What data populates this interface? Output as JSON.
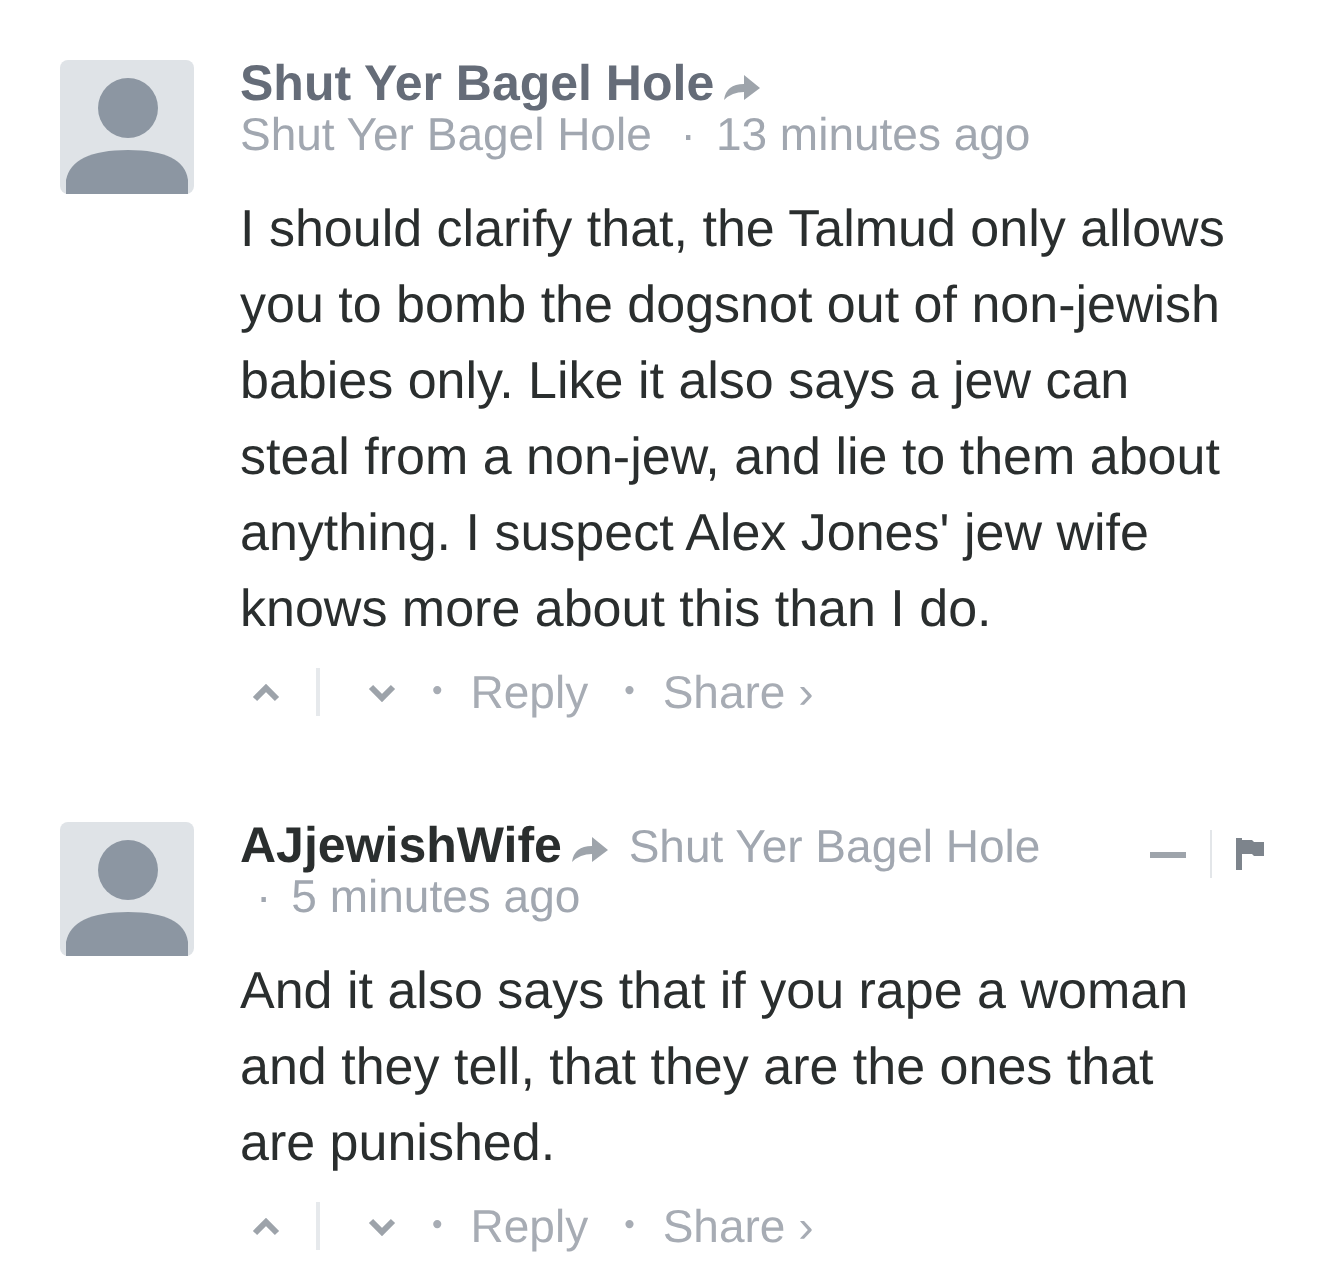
{
  "comments": [
    {
      "author": {
        "name": "Shut Yer Bagel Hole",
        "color": "#656c78"
      },
      "reply_to": "Shut Yer Bagel Hole",
      "separator": "·",
      "time": "13 minutes ago",
      "hovered": false,
      "body": "I should clarify that, the Talmud only allows you to bomb the dogsnot out of non-jewish babies only. Like it also says a jew can steal from a non-jew, and lie to them about anything. I suspect Alex Jones' jew wife knows more about this than I do.",
      "actions": [
        {
          "kind": "upvote"
        },
        {
          "kind": "downvote"
        },
        {
          "kind": "bullet",
          "text": "•"
        },
        {
          "kind": "link",
          "text": "Reply"
        },
        {
          "kind": "bullet",
          "text": "•"
        },
        {
          "kind": "link",
          "text": "Share ›"
        }
      ]
    },
    {
      "author": {
        "name": "AJjewishWife",
        "color": "#2a2e2e"
      },
      "reply_to": "Shut Yer Bagel Hole",
      "separator": "·",
      "time": "5 minutes ago",
      "hovered": true,
      "body": "And it also says that if you rape a woman and they tell, that they are the ones that are punished.",
      "actions": [
        {
          "kind": "upvote"
        },
        {
          "kind": "downvote"
        },
        {
          "kind": "bullet",
          "text": "•"
        },
        {
          "kind": "link",
          "text": "Reply"
        },
        {
          "kind": "bullet",
          "text": "•"
        },
        {
          "kind": "link",
          "text": "Share ›"
        }
      ]
    }
  ]
}
